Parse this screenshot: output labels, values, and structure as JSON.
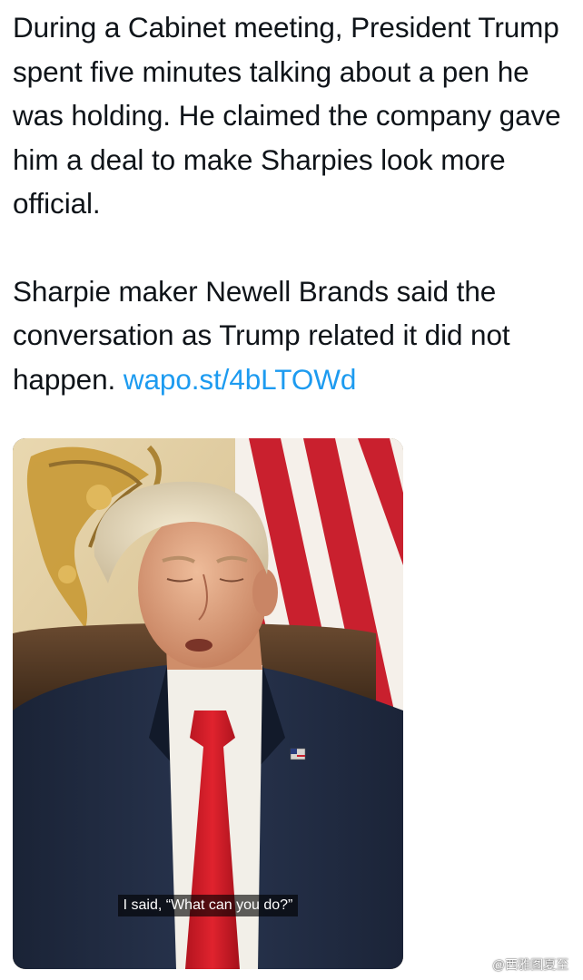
{
  "tweet": {
    "paragraph_1": "During a Cabinet meeting, President Trump spent five minutes talking about a pen he was holding. He claimed the company gave him a deal to make Sharpies look more official.",
    "paragraph_2": "Sharpie maker Newell Brands said the conversation as Trump related it did not happen.",
    "link_text": "wapo.st/4bLTOWd"
  },
  "video": {
    "caption": "I said, “What can you do?”"
  },
  "watermark": {
    "text": "@西雅图夏至",
    "icon": "weibo-logo-icon"
  },
  "colors": {
    "text": "#0f1419",
    "link": "#1d9bf0",
    "background": "#ffffff"
  }
}
